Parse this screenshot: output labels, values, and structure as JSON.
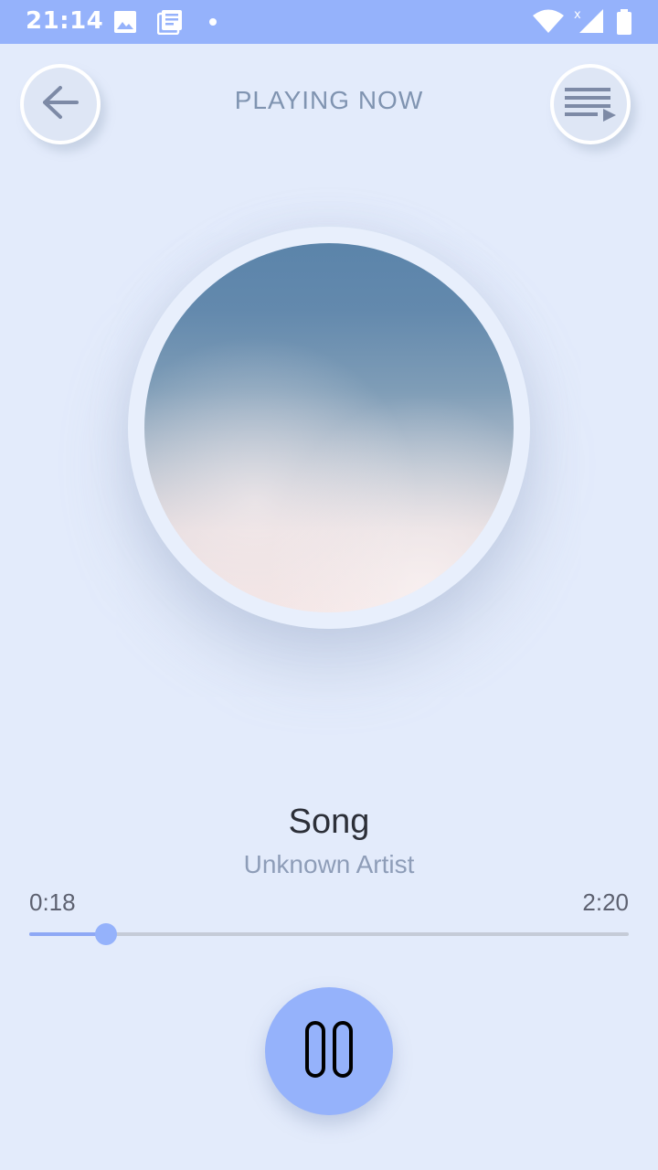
{
  "status_bar": {
    "time": "21:14",
    "icons": [
      "image-icon",
      "news-icon",
      "notification-dot-icon",
      "wifi-icon",
      "signal-icon",
      "battery-icon"
    ],
    "background": "#95b2fb"
  },
  "header": {
    "title": "PLAYING NOW",
    "back_icon": "arrow-left-icon",
    "queue_icon": "queue-music-icon"
  },
  "track": {
    "title": "Song",
    "artist": "Unknown Artist"
  },
  "playback": {
    "current_time": "0:18",
    "total_time": "2:20",
    "progress_fraction": 0.1286,
    "state_icon": "pause-icon"
  },
  "colors": {
    "accent": "#95b2fb",
    "background": "#e3ebfb",
    "title_text": "#8094b1",
    "artist_text": "#8e9db8"
  }
}
